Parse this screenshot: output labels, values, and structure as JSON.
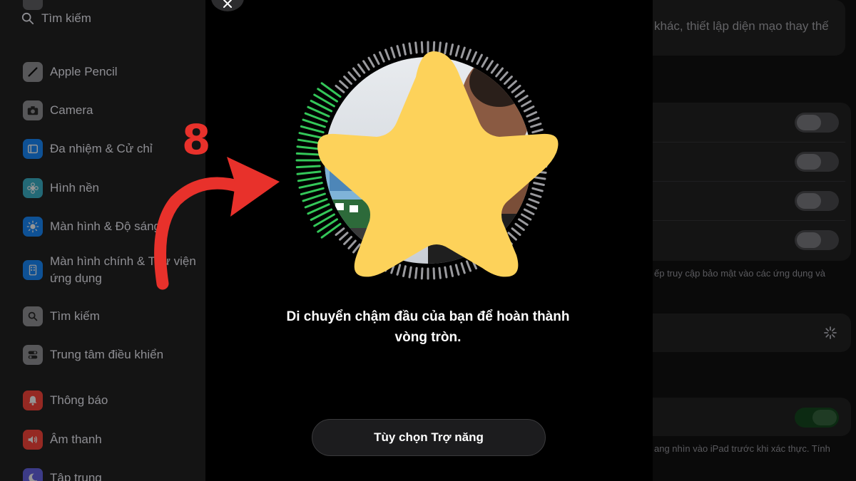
{
  "sidebar": {
    "search_placeholder": "Tìm kiếm",
    "items": [
      {
        "label": "Apple Pencil",
        "icon": "pencil-icon",
        "color": "#8e8e93"
      },
      {
        "label": "Camera",
        "icon": "camera-icon",
        "color": "#8e8e93"
      },
      {
        "label": "Đa nhiệm & Cử chỉ",
        "icon": "multitasking-icon",
        "color": "#0a84ff"
      },
      {
        "label": "Hình nền",
        "icon": "wallpaper-icon",
        "color": "#30b0c7"
      },
      {
        "label": "Màn hình & Độ sáng",
        "icon": "brightness-icon",
        "color": "#0a84ff"
      },
      {
        "label_line1": "Màn hình chính & Thư viện",
        "label_line2": "ứng dụng",
        "icon": "home-screen-icon",
        "color": "#0a84ff"
      },
      {
        "label": "Tìm kiếm",
        "icon": "search-icon",
        "color": "#8e8e93"
      },
      {
        "label": "Trung tâm điều khiển",
        "icon": "control-center-icon",
        "color": "#8e8e93"
      },
      {
        "label": "Thông báo",
        "icon": "bell-icon",
        "color": "#ff3b30"
      },
      {
        "label": "Âm thanh",
        "icon": "speaker-icon",
        "color": "#ff3b30"
      },
      {
        "label": "Tập trung",
        "icon": "moon-icon",
        "color": "#5e5ce6"
      }
    ]
  },
  "modal": {
    "instruction": "Di chuyển chậm đầu của bạn để hoàn thành vòng tròn.",
    "accessibility_button": "Tùy chọn Trợ năng",
    "progress_fraction": 0.2,
    "progress_color": "#34c759"
  },
  "right_panel": {
    "top_text": "khác, thiết lập diện mạo thay thế",
    "footer_text_1": "ếp truy cập bảo mật vào các ứng dụng và",
    "footer_text_2": "ang nhìn vào iPad trước khi xác thực. Tính",
    "toggles": [
      false,
      false,
      false,
      false,
      true
    ]
  },
  "annotation": {
    "step_number": "8",
    "arrow_color": "#e8312b"
  }
}
